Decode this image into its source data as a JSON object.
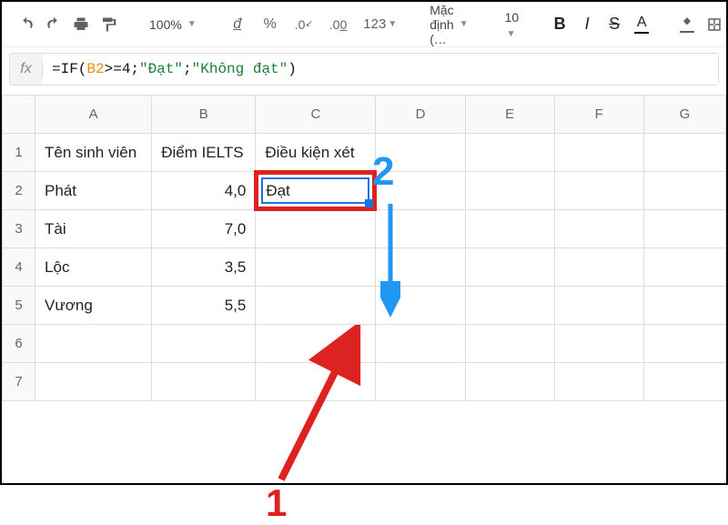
{
  "toolbar": {
    "zoom": "100%",
    "currency": "đ",
    "percent": "%",
    "dec_dec": ".0",
    "dec_inc": ".00",
    "fmt123": "123",
    "font": "Mặc định (…",
    "size": "10",
    "bold": "B",
    "italic": "I",
    "strike": "S",
    "textcolor": "A"
  },
  "formula": {
    "prefix": "=IF(",
    "ref": "B2",
    "mid1": ">=4;",
    "str1": "\"Đạt\"",
    "mid2": ";",
    "str2": "\"Không đạt\"",
    "suffix": ")"
  },
  "columns": [
    "A",
    "B",
    "C",
    "D",
    "E",
    "F",
    "G"
  ],
  "rows": [
    "1",
    "2",
    "3",
    "4",
    "5",
    "6",
    "7"
  ],
  "cells": {
    "A1": "Tên sinh viên",
    "B1": "Điểm IELTS",
    "C1": "Điều kiện xét",
    "A2": "Phát",
    "B2": "4,0",
    "C2": "Đạt",
    "A3": "Tài",
    "B3": "7,0",
    "A4": "Lộc",
    "B4": "3,5",
    "A5": "Vương",
    "B5": "5,5"
  },
  "annotations": {
    "one": "1",
    "two": "2"
  }
}
